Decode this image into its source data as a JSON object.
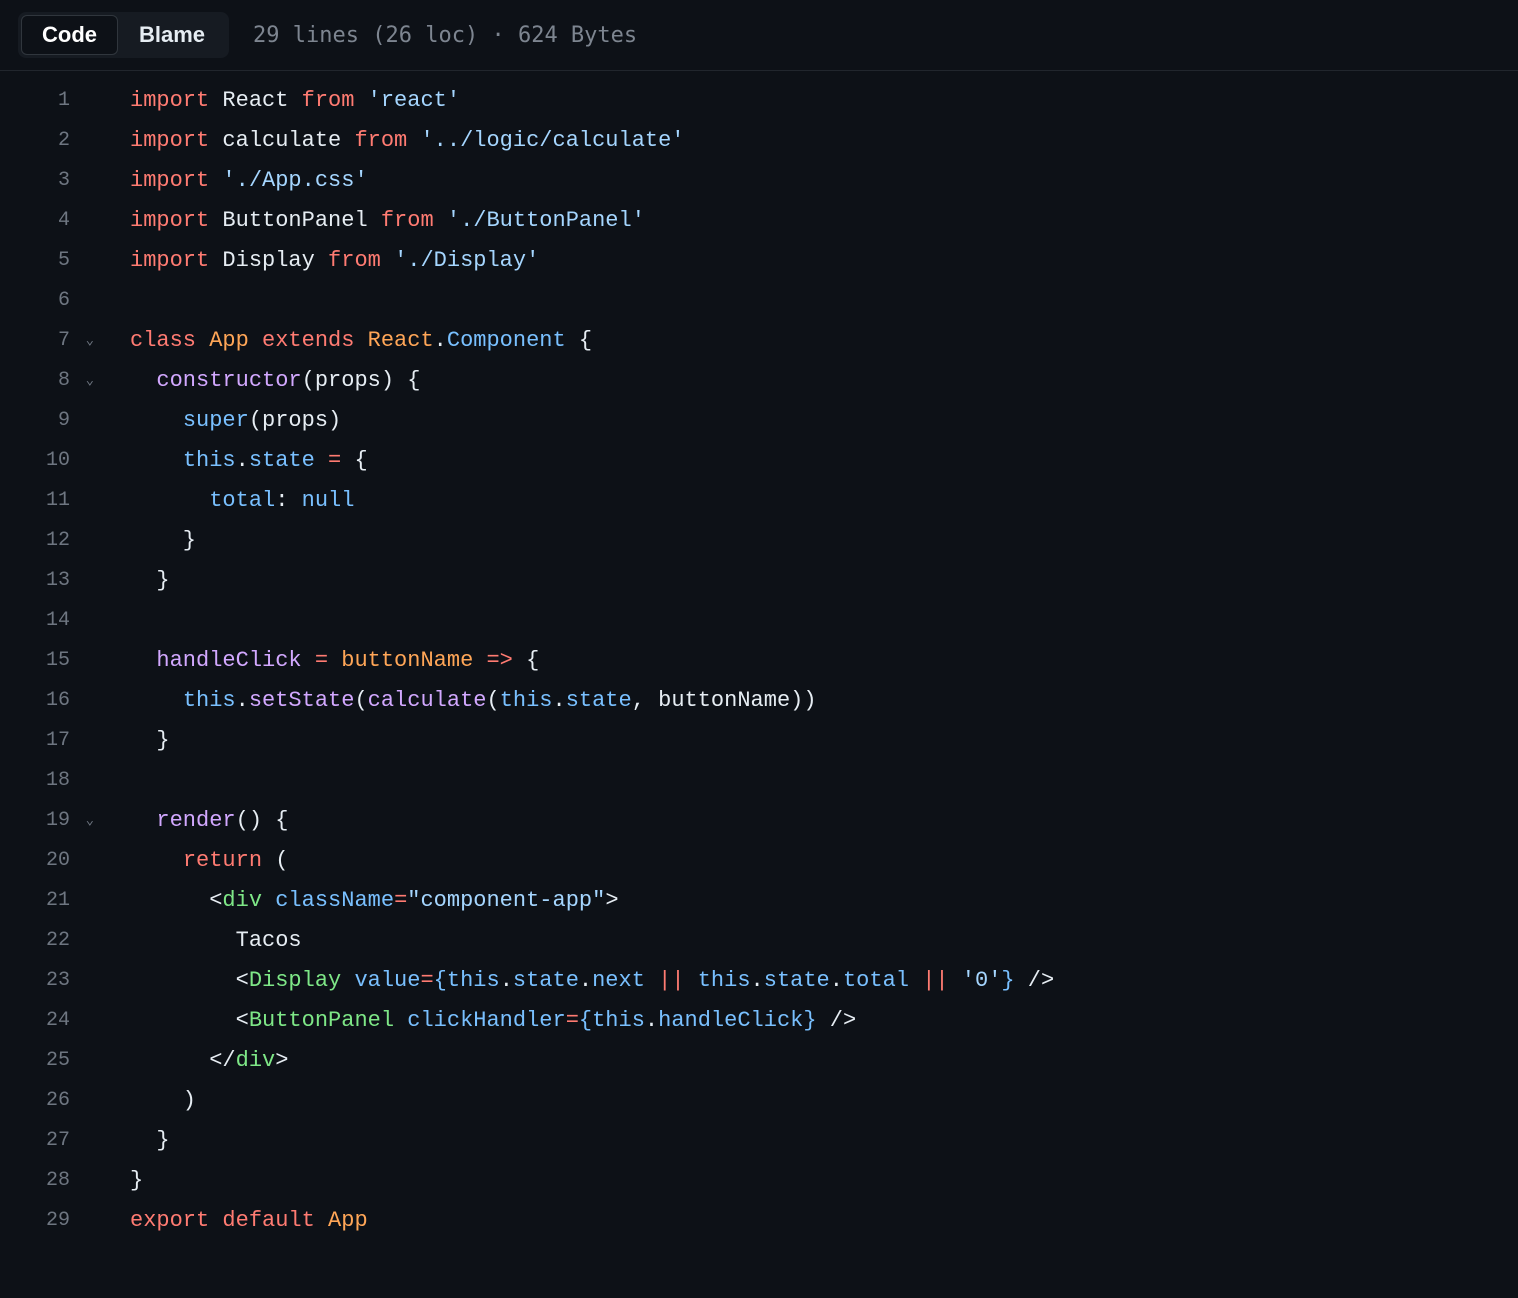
{
  "toolbar": {
    "code_tab": "Code",
    "blame_tab": "Blame",
    "file_info": "29 lines (26 loc) · 624 Bytes"
  },
  "code": {
    "lines": [
      {
        "n": 1,
        "fold": false,
        "tokens": [
          [
            "k-red",
            "import"
          ],
          [
            "k-def",
            " React "
          ],
          [
            "k-red",
            "from"
          ],
          [
            "k-def",
            " "
          ],
          [
            "k-str",
            "'react'"
          ]
        ]
      },
      {
        "n": 2,
        "fold": false,
        "tokens": [
          [
            "k-red",
            "import"
          ],
          [
            "k-def",
            " calculate "
          ],
          [
            "k-red",
            "from"
          ],
          [
            "k-def",
            " "
          ],
          [
            "k-str",
            "'../logic/calculate'"
          ]
        ]
      },
      {
        "n": 3,
        "fold": false,
        "tokens": [
          [
            "k-red",
            "import"
          ],
          [
            "k-def",
            " "
          ],
          [
            "k-str",
            "'./App.css'"
          ]
        ]
      },
      {
        "n": 4,
        "fold": false,
        "tokens": [
          [
            "k-red",
            "import"
          ],
          [
            "k-def",
            " ButtonPanel "
          ],
          [
            "k-red",
            "from"
          ],
          [
            "k-def",
            " "
          ],
          [
            "k-str",
            "'./ButtonPanel'"
          ]
        ]
      },
      {
        "n": 5,
        "fold": false,
        "tokens": [
          [
            "k-red",
            "import"
          ],
          [
            "k-def",
            " Display "
          ],
          [
            "k-red",
            "from"
          ],
          [
            "k-def",
            " "
          ],
          [
            "k-str",
            "'./Display'"
          ]
        ]
      },
      {
        "n": 6,
        "fold": false,
        "tokens": []
      },
      {
        "n": 7,
        "fold": true,
        "tokens": [
          [
            "k-red",
            "class"
          ],
          [
            "k-def",
            " "
          ],
          [
            "k-orn",
            "App"
          ],
          [
            "k-def",
            " "
          ],
          [
            "k-red",
            "extends"
          ],
          [
            "k-def",
            " "
          ],
          [
            "k-orn",
            "React"
          ],
          [
            "k-def",
            "."
          ],
          [
            "k-blue",
            "Component"
          ],
          [
            "k-def",
            " {"
          ]
        ]
      },
      {
        "n": 8,
        "fold": true,
        "tokens": [
          [
            "k-def",
            "  "
          ],
          [
            "k-pur",
            "constructor"
          ],
          [
            "k-def",
            "(props) {"
          ]
        ]
      },
      {
        "n": 9,
        "fold": false,
        "tokens": [
          [
            "k-def",
            "    "
          ],
          [
            "k-blue",
            "super"
          ],
          [
            "k-def",
            "(props)"
          ]
        ]
      },
      {
        "n": 10,
        "fold": false,
        "tokens": [
          [
            "k-def",
            "    "
          ],
          [
            "k-blue",
            "this"
          ],
          [
            "k-def",
            "."
          ],
          [
            "k-blue",
            "state"
          ],
          [
            "k-def",
            " "
          ],
          [
            "k-red",
            "="
          ],
          [
            "k-def",
            " {"
          ]
        ]
      },
      {
        "n": 11,
        "fold": false,
        "tokens": [
          [
            "k-def",
            "      "
          ],
          [
            "k-blue",
            "total"
          ],
          [
            "k-def",
            ": "
          ],
          [
            "k-blue",
            "null"
          ]
        ]
      },
      {
        "n": 12,
        "fold": false,
        "tokens": [
          [
            "k-def",
            "    }"
          ]
        ]
      },
      {
        "n": 13,
        "fold": false,
        "tokens": [
          [
            "k-def",
            "  }"
          ]
        ]
      },
      {
        "n": 14,
        "fold": false,
        "tokens": []
      },
      {
        "n": 15,
        "fold": false,
        "tokens": [
          [
            "k-def",
            "  "
          ],
          [
            "k-pur",
            "handleClick"
          ],
          [
            "k-def",
            " "
          ],
          [
            "k-red",
            "="
          ],
          [
            "k-def",
            " "
          ],
          [
            "k-orn",
            "buttonName"
          ],
          [
            "k-def",
            " "
          ],
          [
            "k-red",
            "=>"
          ],
          [
            "k-def",
            " {"
          ]
        ]
      },
      {
        "n": 16,
        "fold": false,
        "tokens": [
          [
            "k-def",
            "    "
          ],
          [
            "k-blue",
            "this"
          ],
          [
            "k-def",
            "."
          ],
          [
            "k-pur",
            "setState"
          ],
          [
            "k-def",
            "("
          ],
          [
            "k-pur",
            "calculate"
          ],
          [
            "k-def",
            "("
          ],
          [
            "k-blue",
            "this"
          ],
          [
            "k-def",
            "."
          ],
          [
            "k-blue",
            "state"
          ],
          [
            "k-def",
            ", buttonName))"
          ]
        ]
      },
      {
        "n": 17,
        "fold": false,
        "tokens": [
          [
            "k-def",
            "  }"
          ]
        ]
      },
      {
        "n": 18,
        "fold": false,
        "tokens": []
      },
      {
        "n": 19,
        "fold": true,
        "tokens": [
          [
            "k-def",
            "  "
          ],
          [
            "k-pur",
            "render"
          ],
          [
            "k-def",
            "() {"
          ]
        ]
      },
      {
        "n": 20,
        "fold": false,
        "tokens": [
          [
            "k-def",
            "    "
          ],
          [
            "k-red",
            "return"
          ],
          [
            "k-def",
            " ("
          ]
        ]
      },
      {
        "n": 21,
        "fold": false,
        "tokens": [
          [
            "k-def",
            "      <"
          ],
          [
            "k-grn",
            "div"
          ],
          [
            "k-def",
            " "
          ],
          [
            "k-blue",
            "className"
          ],
          [
            "k-red",
            "="
          ],
          [
            "k-str",
            "\"component-app\""
          ],
          [
            "k-def",
            ">"
          ]
        ]
      },
      {
        "n": 22,
        "fold": false,
        "tokens": [
          [
            "k-def",
            "        Tacos"
          ]
        ]
      },
      {
        "n": 23,
        "fold": false,
        "tokens": [
          [
            "k-def",
            "        <"
          ],
          [
            "k-grn",
            "Display"
          ],
          [
            "k-def",
            " "
          ],
          [
            "k-blue",
            "value"
          ],
          [
            "k-red",
            "="
          ],
          [
            "k-blue",
            "{"
          ],
          [
            "k-blue",
            "this"
          ],
          [
            "k-def",
            "."
          ],
          [
            "k-blue",
            "state"
          ],
          [
            "k-def",
            "."
          ],
          [
            "k-blue",
            "next"
          ],
          [
            "k-def",
            " "
          ],
          [
            "k-red",
            "||"
          ],
          [
            "k-def",
            " "
          ],
          [
            "k-blue",
            "this"
          ],
          [
            "k-def",
            "."
          ],
          [
            "k-blue",
            "state"
          ],
          [
            "k-def",
            "."
          ],
          [
            "k-blue",
            "total"
          ],
          [
            "k-def",
            " "
          ],
          [
            "k-red",
            "||"
          ],
          [
            "k-def",
            " "
          ],
          [
            "k-str",
            "'0'"
          ],
          [
            "k-blue",
            "}"
          ],
          [
            "k-def",
            " />"
          ]
        ]
      },
      {
        "n": 24,
        "fold": false,
        "tokens": [
          [
            "k-def",
            "        <"
          ],
          [
            "k-grn",
            "ButtonPanel"
          ],
          [
            "k-def",
            " "
          ],
          [
            "k-blue",
            "clickHandler"
          ],
          [
            "k-red",
            "="
          ],
          [
            "k-blue",
            "{"
          ],
          [
            "k-blue",
            "this"
          ],
          [
            "k-def",
            "."
          ],
          [
            "k-blue",
            "handleClick"
          ],
          [
            "k-blue",
            "}"
          ],
          [
            "k-def",
            " />"
          ]
        ]
      },
      {
        "n": 25,
        "fold": false,
        "tokens": [
          [
            "k-def",
            "      </"
          ],
          [
            "k-grn",
            "div"
          ],
          [
            "k-def",
            ">"
          ]
        ]
      },
      {
        "n": 26,
        "fold": false,
        "tokens": [
          [
            "k-def",
            "    )"
          ]
        ]
      },
      {
        "n": 27,
        "fold": false,
        "tokens": [
          [
            "k-def",
            "  }"
          ]
        ]
      },
      {
        "n": 28,
        "fold": false,
        "tokens": [
          [
            "k-def",
            "}"
          ]
        ]
      },
      {
        "n": 29,
        "fold": false,
        "tokens": [
          [
            "k-red",
            "export"
          ],
          [
            "k-def",
            " "
          ],
          [
            "k-red",
            "default"
          ],
          [
            "k-def",
            " "
          ],
          [
            "k-orn",
            "App"
          ]
        ]
      }
    ]
  }
}
